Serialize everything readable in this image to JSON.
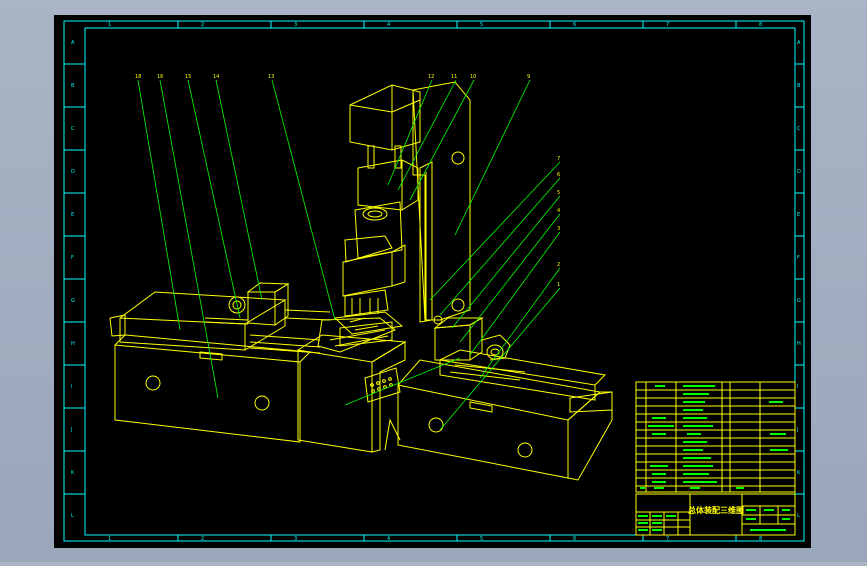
{
  "drawing": {
    "title": "总体装配三维图",
    "colors": {
      "paper": "#000000",
      "frame": "#00ffff",
      "model": "#ffff00",
      "leaders": "#00ff00",
      "outside": "#a9b4c6"
    }
  },
  "zones": {
    "top": [
      "1",
      "2",
      "3",
      "4",
      "5",
      "6",
      "7",
      "8"
    ],
    "bottom": [
      "1",
      "2",
      "3",
      "4",
      "5",
      "6",
      "7",
      "8"
    ],
    "left": [
      "A",
      "B",
      "C",
      "D",
      "E",
      "F",
      "G",
      "H",
      "I",
      "J",
      "K",
      "L"
    ],
    "right": [
      "A",
      "B",
      "C",
      "D",
      "E",
      "F",
      "G",
      "H",
      "I",
      "J",
      "K",
      "L"
    ]
  },
  "leaders": {
    "top_labels": [
      "18",
      "16",
      "15",
      "14",
      "13",
      "12",
      "11",
      "10",
      "9"
    ],
    "right_labels": [
      "7",
      "6",
      "5",
      "4",
      "3",
      "2",
      "1"
    ]
  }
}
